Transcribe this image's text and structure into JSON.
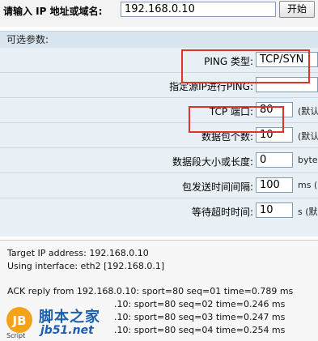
{
  "top": {
    "prompt": "请输入 IP 地址或域名:",
    "target_value": "192.168.0.10",
    "start_label": "开始"
  },
  "params": {
    "title": "可选参数:",
    "rows": [
      {
        "label": "PING 类型:",
        "value": "TCP/SYN",
        "unit": ""
      },
      {
        "label": "指定源IP进行PING:",
        "value": "",
        "unit": ""
      },
      {
        "label": "TCP 端口:",
        "value": "80",
        "unit": "(默认"
      },
      {
        "label": "数据包个数:",
        "value": "10",
        "unit": "(默认"
      },
      {
        "label": "数据段大小或长度:",
        "value": "0",
        "unit": "byte"
      },
      {
        "label": "包发送时间间隔:",
        "value": "100",
        "unit": "ms ("
      },
      {
        "label": "等待超时时间:",
        "value": "10",
        "unit": "s (默"
      }
    ]
  },
  "output": {
    "lines": [
      "Target IP address: 192.168.0.10",
      "Using interface: eth2 [192.168.0.1]",
      "",
      "ACK reply from 192.168.0.10: sport=80 seq=01 time=0.789 ms",
      ".10: sport=80 seq=02 time=0.246 ms",
      ".10: sport=80 seq=03 time=0.247 ms",
      ".10: sport=80 seq=04 time=0.254 ms"
    ]
  },
  "watermark": {
    "logo_text": "JB",
    "sub_text": "Script",
    "cn_text": "脚本之家",
    "url_text": "jb51.net"
  },
  "colors": {
    "highlight": "#e0322f",
    "panel_bg": "#e8f0f5",
    "watermark_blue": "#1b5fb0"
  }
}
